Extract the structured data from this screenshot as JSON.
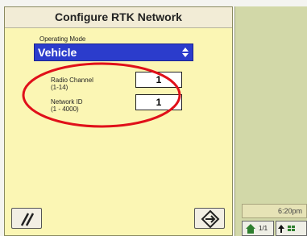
{
  "dialog": {
    "title": "Configure RTK Network",
    "operating_mode": {
      "label": "Operating Mode",
      "value": "Vehicle"
    },
    "radio_channel": {
      "label_line1": "Radio Channel",
      "label_line2": "(1-14)",
      "value": "1"
    },
    "network_id": {
      "label_line1": "Network ID",
      "label_line2": "(1 - 4000)",
      "value": "1"
    }
  },
  "sidebar": {
    "clock_text": "6:20pm",
    "page_indicator": "1/1"
  }
}
